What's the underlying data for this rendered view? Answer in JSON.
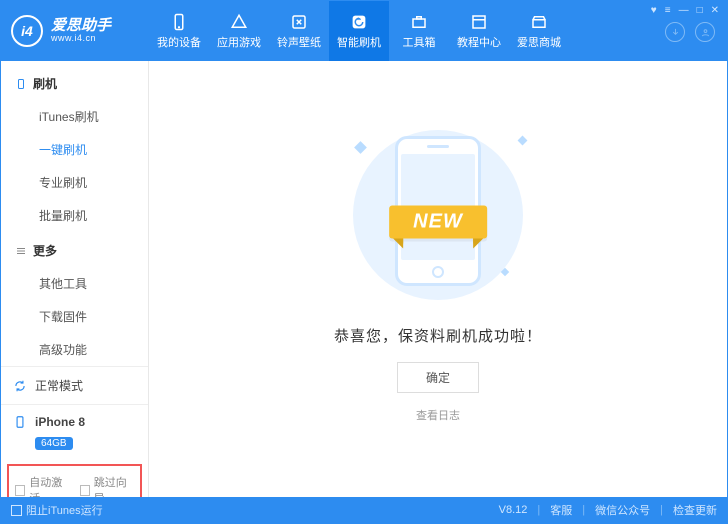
{
  "brand": {
    "name": "爱思助手",
    "url": "www.i4.cn",
    "badge": "i4"
  },
  "nav": [
    {
      "label": "我的设备",
      "icon": "device"
    },
    {
      "label": "应用游戏",
      "icon": "apps"
    },
    {
      "label": "铃声壁纸",
      "icon": "ringtone"
    },
    {
      "label": "智能刷机",
      "icon": "flash",
      "active": true
    },
    {
      "label": "工具箱",
      "icon": "tools"
    },
    {
      "label": "教程中心",
      "icon": "book"
    },
    {
      "label": "爱思商城",
      "icon": "store"
    }
  ],
  "sidebar": {
    "section1": {
      "title": "刷机",
      "items": [
        "iTunes刷机",
        "一键刷机",
        "专业刷机",
        "批量刷机"
      ],
      "activeIndex": 1
    },
    "section2": {
      "title": "更多",
      "items": [
        "其他工具",
        "下载固件",
        "高级功能"
      ]
    },
    "statusMode": "正常模式",
    "device": {
      "name": "iPhone 8",
      "storage": "64GB"
    },
    "options": {
      "autoActivate": "自动激活",
      "skipSetup": "跳过向导"
    }
  },
  "main": {
    "ribbon": "NEW",
    "message": "恭喜您，保资料刷机成功啦！",
    "okButton": "确定",
    "viewLog": "查看日志"
  },
  "footer": {
    "blockItunes": "阻止iTunes运行",
    "version": "V8.12",
    "support": "客服",
    "wechat": "微信公众号",
    "update": "检查更新"
  }
}
